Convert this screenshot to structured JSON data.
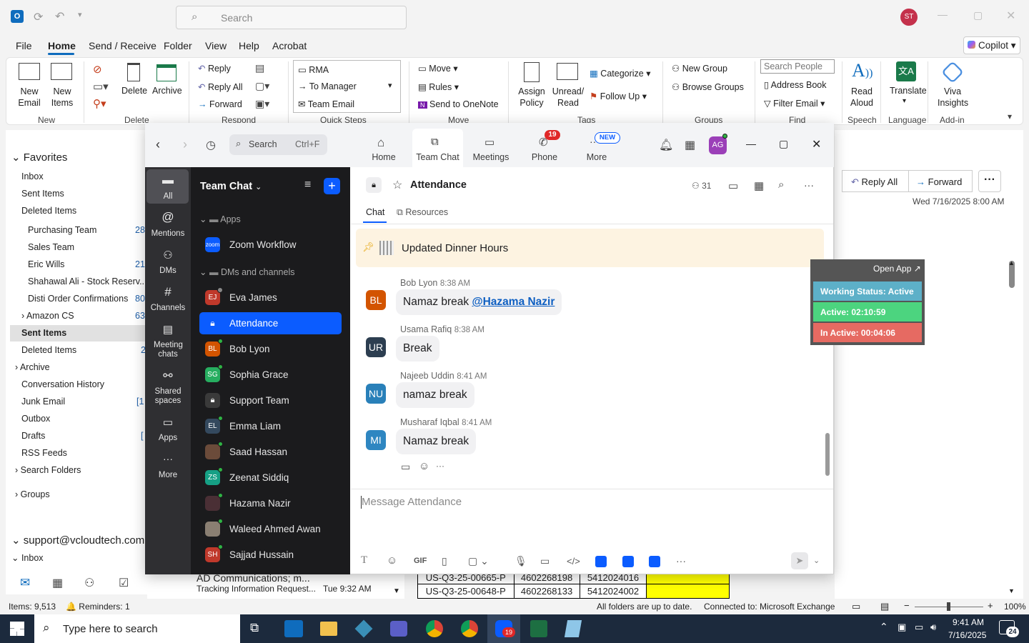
{
  "outlook": {
    "search_placeholder": "Search",
    "user_initials": "ST",
    "menu": [
      "File",
      "Home",
      "Send / Receive",
      "Folder",
      "View",
      "Help",
      "Acrobat"
    ],
    "copilot": "Copilot",
    "ribbon": {
      "new_email": "New Email",
      "new_items": "New Items",
      "group_new": "New",
      "delete": "Delete",
      "archive": "Archive",
      "group_delete": "Delete",
      "reply": "Reply",
      "reply_all": "Reply All",
      "forward": "Forward",
      "group_respond": "Respond",
      "qs1": "RMA",
      "qs2": "To Manager",
      "qs3": "Team Email",
      "group_quick": "Quick Steps",
      "move": "Move",
      "rules": "Rules",
      "onenote": "Send to OneNote",
      "group_move": "Move",
      "assign_policy": "Assign Policy",
      "unread_read": "Unread/ Read",
      "categorize": "Categorize",
      "follow_up": "Follow Up",
      "group_tags": "Tags",
      "new_group": "New Group",
      "browse_groups": "Browse Groups",
      "group_groups": "Groups",
      "search_people": "Search People",
      "address_book": "Address Book",
      "filter_email": "Filter Email",
      "group_find": "Find",
      "read_aloud": "Read Aloud",
      "group_speech": "Speech",
      "translate": "Translate",
      "group_language": "Language",
      "viva": "Viva Insights",
      "group_addin": "Add-in"
    },
    "folders": {
      "favorites": "Favorites",
      "fav_inbox": "Inbox",
      "fav_sent": "Sent Items",
      "fav_deleted": "Deleted Items",
      "f1": "Purchasing Team",
      "f1c": "28",
      "f2": "Sales Team",
      "f3": "Eric Wills",
      "f3c": "21",
      "f4": "Shahawal Ali - Stock Reserv...",
      "f5": "Disti Order Confirmations",
      "f5c": "80",
      "f6": "Amazon CS",
      "f6c": "63",
      "f7": "Sent Items",
      "f8": "Deleted Items",
      "f8c": "2",
      "f9": "Archive",
      "f10": "Conversation History",
      "f11": "Junk Email",
      "f11c": "[1",
      "f12": "Outbox",
      "f13": "Drafts",
      "f13c": "[",
      "f14": "RSS Feeds",
      "f15": "Search Folders",
      "groups": "Groups",
      "account": "support@vcloudtech.com",
      "inbox": "Inbox"
    },
    "mail_peek": {
      "sender": "AD Communications; m...",
      "subject": "Tracking Information Request...",
      "time": "Tue 9:32 AM"
    },
    "table_rows": [
      [
        "US-Q3-25-00665-P",
        "4602268198",
        "5412024016"
      ],
      [
        "US-Q3-25-00648-P",
        "4602268133",
        "5412024002"
      ]
    ],
    "reading": {
      "reply_all": "Reply All",
      "forward": "Forward",
      "date": "Wed 7/16/2025 8:00 AM"
    },
    "status": {
      "items": "Items: 9,513",
      "reminders": "Reminders: 1",
      "sync": "All folders are up to date.",
      "connected": "Connected to: Microsoft Exchange",
      "zoom": "100%"
    }
  },
  "widget": {
    "open_app": "Open App",
    "working": "Working Status: Active",
    "active": "Active: 02:10:59",
    "inactive": "In Active: 00:04:06"
  },
  "zoom": {
    "search": "Search",
    "shortcut": "Ctrl+F",
    "tabs": [
      {
        "label": "Home"
      },
      {
        "label": "Team Chat"
      },
      {
        "label": "Meetings"
      },
      {
        "label": "Phone",
        "badge": "19"
      },
      {
        "label": "More",
        "badge": "NEW"
      }
    ],
    "user_initials": "AG",
    "rail": [
      "All",
      "Mentions",
      "DMs",
      "Channels",
      "Meeting chats",
      "Shared spaces",
      "Apps",
      "More"
    ],
    "list_title": "Team Chat",
    "sec_apps": "Apps",
    "app1": "Zoom Workflow",
    "app1_logo": "zoom",
    "sec_dms": "DMs and channels",
    "channels": [
      {
        "name": "Eva James",
        "init": "EJ",
        "color": "#c0392b"
      },
      {
        "name": "Attendance",
        "init": "",
        "color": "#ffffff"
      },
      {
        "name": "Bob Lyon",
        "init": "BL",
        "color": "#d35400"
      },
      {
        "name": "Sophia Grace",
        "init": "SG",
        "color": "#27ae60"
      },
      {
        "name": "Support Team",
        "init": "",
        "color": "#3a3a3a"
      },
      {
        "name": "Emma Liam",
        "init": "EL",
        "color": "#34495e"
      },
      {
        "name": "Saad Hassan",
        "init": "",
        "color": "#6b4b3a"
      },
      {
        "name": "Zeenat Siddiq",
        "init": "ZS",
        "color": "#16a085"
      },
      {
        "name": "Hazama Nazir",
        "init": "",
        "color": "#4a2f35"
      },
      {
        "name": "Waleed Ahmed Awan",
        "init": "",
        "color": "#8a7f72"
      },
      {
        "name": "Sajjad Hussain",
        "init": "SH",
        "color": "#c0392b"
      }
    ],
    "channel_title": "Attendance",
    "member_count": "31",
    "tab_chat": "Chat",
    "tab_resources": "Resources",
    "pinned": "Updated Dinner Hours",
    "messages": [
      {
        "sender": "Bob Lyon",
        "time": "8:38 AM",
        "init": "BL",
        "color": "#d35400",
        "text": "Namaz break ",
        "mention": "@Hazama Nazir"
      },
      {
        "sender": "Usama Rafiq",
        "time": "8:38 AM",
        "init": "UR",
        "color": "#2c3e50",
        "text": "Break"
      },
      {
        "sender": "Najeeb Uddin",
        "time": "8:41 AM",
        "init": "NU",
        "color": "#2980b9",
        "text": "namaz break"
      },
      {
        "sender": "Musharaf Iqbal",
        "time": "8:41 AM",
        "init": "MI",
        "color": "#2e86c1",
        "text": "Namaz break"
      }
    ],
    "compose_placeholder": "Message Attendance"
  },
  "taskbar": {
    "search": "Type here to search",
    "time": "9:41 AM",
    "date": "7/16/2025",
    "notif": "24",
    "zoom_badge": "19"
  }
}
